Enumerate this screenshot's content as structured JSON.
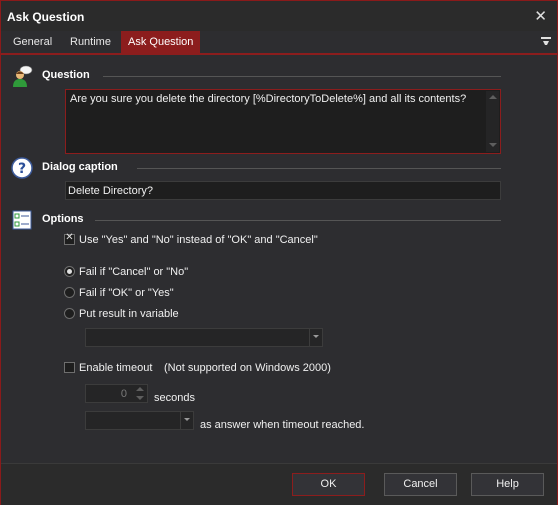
{
  "window": {
    "title": "Ask Question"
  },
  "tabs": [
    {
      "label": "General"
    },
    {
      "label": "Runtime"
    },
    {
      "label": "Ask Question"
    }
  ],
  "question": {
    "heading": "Question",
    "value": "Are you sure you delete the directory [%DirectoryToDelete%] and all its contents?"
  },
  "caption": {
    "heading": "Dialog caption",
    "value": "Delete Directory?"
  },
  "options": {
    "heading": "Options",
    "use_yes_no": {
      "label": "Use \"Yes\" and \"No\" instead of \"OK\" and \"Cancel\"",
      "checked": true
    },
    "radios": [
      {
        "label": "Fail if \"Cancel\" or \"No\"",
        "selected": true
      },
      {
        "label": "Fail if \"OK\" or \"Yes\"",
        "selected": false
      },
      {
        "label": "Put result in variable",
        "selected": false
      }
    ],
    "result_variable": {
      "value": ""
    },
    "timeout": {
      "label": "Enable timeout",
      "note": "(Not supported on Windows 2000)",
      "checked": false,
      "seconds_value": "0",
      "seconds_label": "seconds",
      "answer_value": "",
      "answer_suffix": "as answer when timeout reached."
    }
  },
  "buttons": {
    "ok": "OK",
    "cancel": "Cancel",
    "help": "Help"
  },
  "colors": {
    "accent": "#8c1d1d",
    "background": "#2d2d30",
    "field": "#1e1e1e"
  },
  "icons": {
    "question": "person-speech-icon",
    "caption": "question-mark-icon",
    "options": "options-list-icon"
  }
}
